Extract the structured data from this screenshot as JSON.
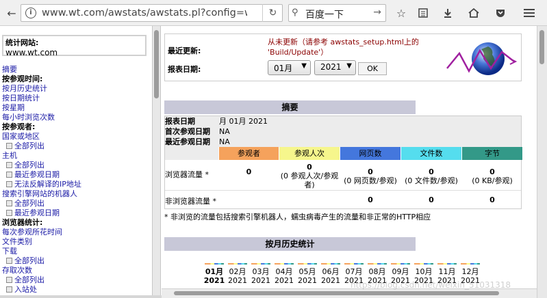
{
  "browser": {
    "url": "www.wt.com/awstats/awstats.pl?config=www",
    "search_text": "百度一下"
  },
  "left": {
    "site_label": "统计网站:",
    "site_value": "www.wt.com",
    "menu": [
      {
        "type": "link",
        "text": "摘要"
      },
      {
        "type": "heading",
        "text": "按参观时间:"
      },
      {
        "type": "link",
        "text": "按月历史统计"
      },
      {
        "type": "link",
        "text": "按日期统计"
      },
      {
        "type": "link",
        "text": "按星期"
      },
      {
        "type": "link",
        "text": "每小时浏览次数"
      },
      {
        "type": "heading",
        "text": "按参观者:"
      },
      {
        "type": "link",
        "text": "国家或地区"
      },
      {
        "type": "sub",
        "text": "全部列出"
      },
      {
        "type": "link",
        "text": "主机"
      },
      {
        "type": "sub",
        "text": "全部列出"
      },
      {
        "type": "sub",
        "text": "最近参观日期"
      },
      {
        "type": "sub",
        "text": "无法反解译的IP地址"
      },
      {
        "type": "link",
        "text": "搜索引擎网站的机器人"
      },
      {
        "type": "sub",
        "text": "全部列出"
      },
      {
        "type": "sub",
        "text": "最近参观日期"
      },
      {
        "type": "heading",
        "text": "浏览器统计:"
      },
      {
        "type": "link",
        "text": "每次参观所花时间"
      },
      {
        "type": "link",
        "text": "文件类别"
      },
      {
        "type": "link",
        "text": "下载"
      },
      {
        "type": "sub",
        "text": "全部列出"
      },
      {
        "type": "link",
        "text": "存取次数"
      },
      {
        "type": "sub",
        "text": "全部列出"
      },
      {
        "type": "sub",
        "text": "入站处"
      }
    ]
  },
  "info": {
    "last_update_label": "最近更新:",
    "last_update_value": "从未更新（请参考 awstats_setup.html上的 'Build/Update'）",
    "report_date_label": "报表日期:",
    "month_value": "01月",
    "year_value": "2021",
    "ok_label": "OK"
  },
  "summary": {
    "title": "摘要",
    "report_date_label": "报表日期",
    "report_date_value": "月 01月 2021",
    "first_visit_label": "首次参观日期",
    "first_visit_value": "NA",
    "last_visit_label": "最近参观日期",
    "last_visit_value": "NA",
    "columns": [
      {
        "label": "参观者",
        "color": "#f5a25c"
      },
      {
        "label": "参观人次",
        "color": "#f6f68c"
      },
      {
        "label": "网页数",
        "color": "#4477dd"
      },
      {
        "label": "文件数",
        "color": "#55ddee"
      },
      {
        "label": "字节",
        "color": "#339988"
      }
    ],
    "browser_label": "浏览器流量 *",
    "browser_values": [
      {
        "main": "0",
        "sub": ""
      },
      {
        "main": "0",
        "sub": "(0 参观人次/参观者)"
      },
      {
        "main": "0",
        "sub": "(0 网页数/参观)"
      },
      {
        "main": "0",
        "sub": "(0 文件数/参观)"
      },
      {
        "main": "0",
        "sub": "(0 KB/参观)"
      }
    ],
    "nonbrowser_label": "非浏览器流量 *",
    "nonbrowser_values": [
      "0",
      "0",
      "0"
    ],
    "note": "* 非浏览的流量包括搜索引擎机器人，蠕虫病毒产生的流量和非正常的HTTP相应"
  },
  "monthly": {
    "title": "按月历史统计",
    "months": [
      "01月",
      "02月",
      "03月",
      "04月",
      "05月",
      "06月",
      "07月",
      "08月",
      "09月",
      "10月",
      "11月",
      "12月"
    ],
    "year": "2021"
  },
  "watermark": "https://blog.csdn.net/weixin_51031318"
}
